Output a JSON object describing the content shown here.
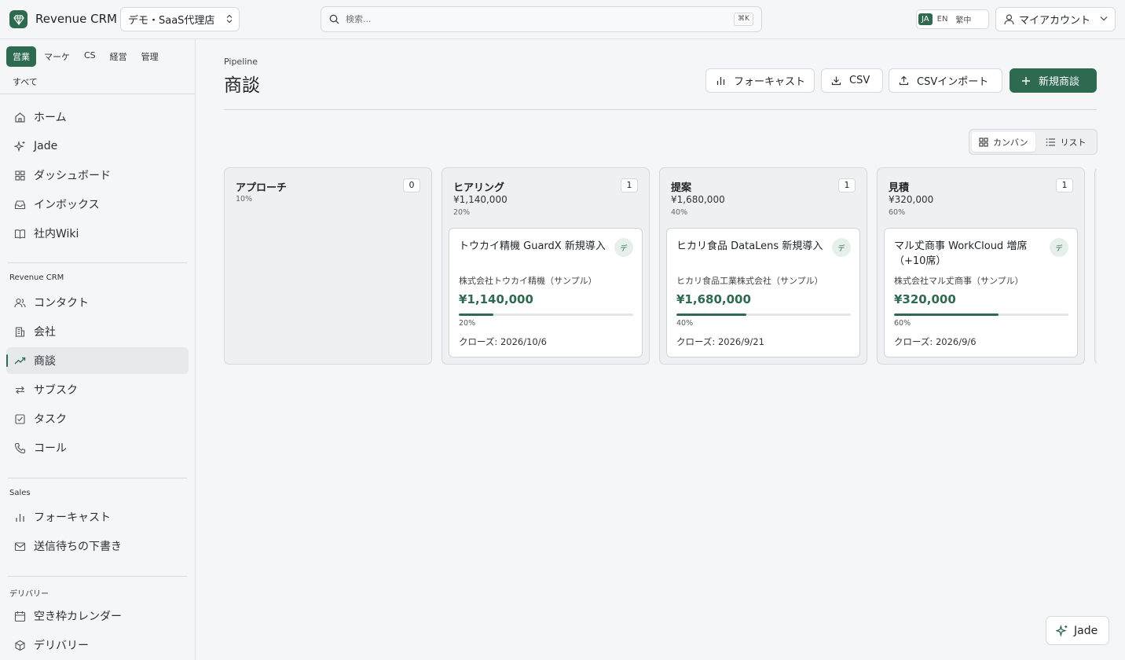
{
  "header": {
    "brand": "Revenue CRM",
    "org": "デモ・SaaS代理店",
    "search_placeholder": "検索...",
    "search_shortcut": "⌘K",
    "languages": [
      "JA",
      "EN",
      "繁中"
    ],
    "active_language": "JA",
    "account": "マイアカウント"
  },
  "sidebar": {
    "dept_tabs": [
      "営業",
      "マーケ",
      "CS",
      "経営",
      "管理",
      "すべて"
    ],
    "active_dept": "営業",
    "general": [
      {
        "label": "ホーム",
        "icon": "home-icon"
      },
      {
        "label": "Jade",
        "icon": "sparkle-icon"
      },
      {
        "label": "ダッシュボード",
        "icon": "dashboard-icon"
      },
      {
        "label": "インボックス",
        "icon": "inbox-icon"
      },
      {
        "label": "社内Wiki",
        "icon": "book-icon"
      }
    ],
    "crm_section": "Revenue CRM",
    "crm": [
      {
        "label": "コンタクト",
        "icon": "users-icon"
      },
      {
        "label": "会社",
        "icon": "building-icon"
      },
      {
        "label": "商談",
        "icon": "trend-icon"
      },
      {
        "label": "サブスク",
        "icon": "repeat-icon"
      },
      {
        "label": "タスク",
        "icon": "checkbox-icon"
      },
      {
        "label": "コール",
        "icon": "phone-icon"
      }
    ],
    "active_item": "商談",
    "sales_section": "Sales",
    "sales": [
      {
        "label": "フォーキャスト",
        "icon": "bar-chart-icon"
      },
      {
        "label": "送信待ちの下書き",
        "icon": "mail-icon"
      }
    ],
    "delivery_section": "デリバリー",
    "delivery": [
      {
        "label": "空き枠カレンダー",
        "icon": "calendar-icon"
      },
      {
        "label": "デリバリー",
        "icon": "package-icon"
      }
    ]
  },
  "page": {
    "eyebrow": "Pipeline",
    "title": "商談",
    "actions": {
      "forecast": "フォーキャスト",
      "csv": "CSV",
      "csv_import": "CSVインポート",
      "new_deal": "新規商談"
    },
    "views": {
      "kanban": "カンバン",
      "list": "リスト",
      "active": "kanban"
    }
  },
  "board": {
    "columns": [
      {
        "name": "アプローチ",
        "count": "0",
        "amount": "",
        "probability": "10%",
        "cards": []
      },
      {
        "name": "ヒアリング",
        "count": "1",
        "amount": "¥1,140,000",
        "probability": "20%",
        "cards": [
          {
            "title": "トウカイ精機 GuardX 新規導入",
            "company": "株式会社トウカイ精機（サンプル）",
            "amount": "¥1,140,000",
            "progress": 0.2,
            "progress_label": "20%",
            "close": "クローズ: 2026/10/6",
            "owner": "デ"
          }
        ]
      },
      {
        "name": "提案",
        "count": "1",
        "amount": "¥1,680,000",
        "probability": "40%",
        "cards": [
          {
            "title": "ヒカリ食品 DataLens 新規導入",
            "company": "ヒカリ食品工業株式会社（サンプル）",
            "amount": "¥1,680,000",
            "progress": 0.4,
            "progress_label": "40%",
            "close": "クローズ: 2026/9/21",
            "owner": "デ"
          }
        ]
      },
      {
        "name": "見積",
        "count": "1",
        "amount": "¥320,000",
        "probability": "60%",
        "cards": [
          {
            "title": "マル𠀋商事 WorkCloud 増席（+10席）",
            "company": "株式会社マル𠀋商事（サンプル）",
            "amount": "¥320,000",
            "progress": 0.6,
            "progress_label": "60%",
            "close": "クローズ: 2026/9/6",
            "owner": "デ"
          }
        ]
      }
    ]
  },
  "fab": {
    "label": "Jade"
  },
  "colors": {
    "accent": "#2d6a4f",
    "background": "#f4f6f8",
    "border": "#d4d9de"
  }
}
